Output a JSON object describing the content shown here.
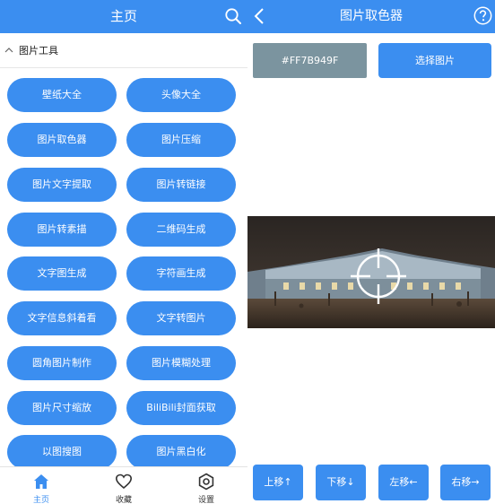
{
  "left_panel": {
    "header": {
      "title": "主页",
      "search_icon": "search-icon"
    },
    "section": {
      "label": "图片工具",
      "chevron_icon": "chevron-up-icon"
    },
    "tools": [
      "壁纸大全",
      "头像大全",
      "图片取色器",
      "图片压缩",
      "图片文字提取",
      "图片转链接",
      "图片转素描",
      "二维码生成",
      "文字图生成",
      "字符画生成",
      "文字信息斜着看",
      "文字转图片",
      "圆角图片制作",
      "图片模糊处理",
      "图片尺寸缩放",
      "BiliBili封面获取",
      "以图搜图",
      "图片黑白化"
    ],
    "nav": [
      {
        "label": "主页",
        "icon": "home-icon",
        "active": true
      },
      {
        "label": "收藏",
        "icon": "heart-icon",
        "active": false
      },
      {
        "label": "设置",
        "icon": "settings-icon",
        "active": false
      }
    ]
  },
  "right_panel": {
    "header": {
      "title": "图片取色器",
      "back_icon": "back-arrow-icon",
      "help_icon": "help-icon"
    },
    "color_value": "#FF7B949F",
    "select_button": "选择图片",
    "picker_icon": "crosshair-icon",
    "move_buttons": {
      "up": "上移↑",
      "down": "下移↓",
      "left": "左移←",
      "right": "右移→"
    }
  },
  "colors": {
    "primary": "#3b8ef0",
    "picked_color": "#7b949f"
  }
}
